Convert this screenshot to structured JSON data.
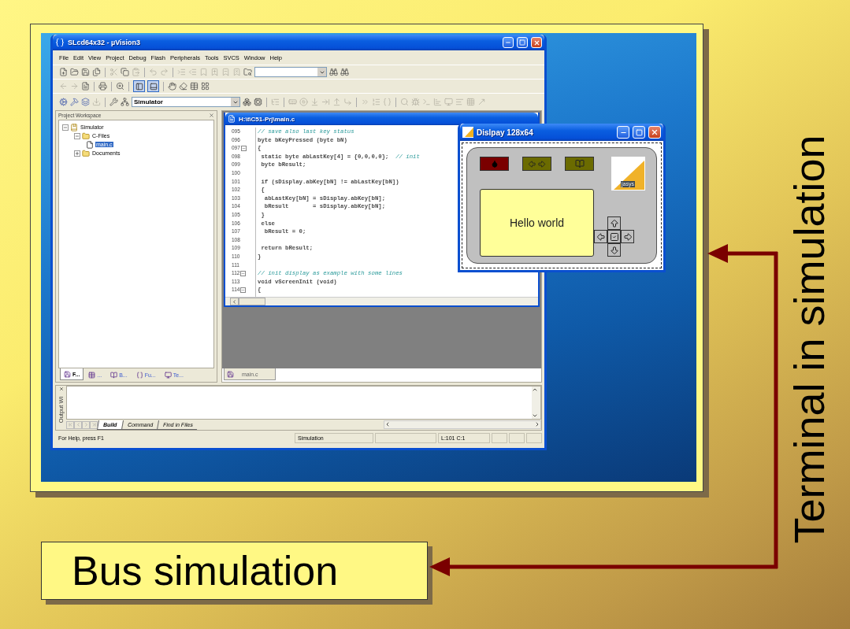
{
  "slide": {
    "side_label": "Terminal in simulation",
    "bottom_label": "Bus simulation"
  },
  "ide": {
    "title": "SLcd64x32  - µVision3",
    "menu": [
      "File",
      "Edit",
      "View",
      "Project",
      "Debug",
      "Flash",
      "Peripherals",
      "Tools",
      "SVCS",
      "Window",
      "Help"
    ],
    "target": "Simulator",
    "workspace": {
      "title": "Project Workspace",
      "tree": [
        {
          "label": "Simulator",
          "kind": "project",
          "expanded": true,
          "selected": false,
          "children": [
            {
              "label": "C-Files",
              "kind": "folder",
              "expanded": true,
              "selected": false,
              "children": [
                {
                  "label": "main.c",
                  "kind": "file",
                  "selected": true
                }
              ]
            },
            {
              "label": "Documents",
              "kind": "folder",
              "expanded": false,
              "selected": false
            }
          ]
        }
      ],
      "tabs": [
        {
          "label": "F...",
          "selected": true
        },
        {
          "label": "...",
          "selected": false
        },
        {
          "label": "B...",
          "selected": false
        },
        {
          "label": "Fu...",
          "selected": false
        },
        {
          "label": "Te...",
          "selected": false
        }
      ]
    },
    "editor": {
      "title": "H:\\t\\C51-Prj\\main.c",
      "lines": [
        {
          "num": "095",
          "comment": "// save also last key status"
        },
        {
          "num": "096",
          "code": "byte bKeyPressed (byte bN)"
        },
        {
          "num": "097",
          "code": "{",
          "fold": true
        },
        {
          "num": "098",
          "code": " static byte abLastKey[4] = {0,0,0,0};  ",
          "comment": "// init"
        },
        {
          "num": "099",
          "code": " byte bResult;"
        },
        {
          "num": "100"
        },
        {
          "num": "101",
          "code": " if (sDisplay.abKey[bN] != abLastKey[bN])"
        },
        {
          "num": "102",
          "code": " {"
        },
        {
          "num": "103",
          "code": "  abLastKey[bN] = sDisplay.abKey[bN];"
        },
        {
          "num": "104",
          "code": "  bResult       = sDisplay.abKey[bN];"
        },
        {
          "num": "105",
          "code": " }"
        },
        {
          "num": "106",
          "code": " else"
        },
        {
          "num": "107",
          "code": "  bResult = 0;"
        },
        {
          "num": "108"
        },
        {
          "num": "109",
          "code": " return bResult;"
        },
        {
          "num": "110",
          "code": "}"
        },
        {
          "num": "111"
        },
        {
          "num": "112",
          "comment": "// init display as example with some lines",
          "fold": true
        },
        {
          "num": "113",
          "code": "void vScreenInit (void)"
        },
        {
          "num": "114",
          "code": "{",
          "fold": true
        }
      ],
      "tabs": [
        {
          "label": "main.c",
          "selected": true
        }
      ]
    },
    "output": {
      "title": "Output Wi",
      "tabs": [
        {
          "label": "Build",
          "selected": true
        },
        {
          "label": "Command",
          "selected": false
        },
        {
          "label": "Find in Files",
          "selected": false
        }
      ]
    },
    "status_bar": {
      "help": "For Help, press F1",
      "mode": "Simulation",
      "position": "L:101 C:1"
    }
  },
  "display": {
    "title": "Dislpay 128x64",
    "logo": "jasys",
    "lcd": "Hello world"
  }
}
